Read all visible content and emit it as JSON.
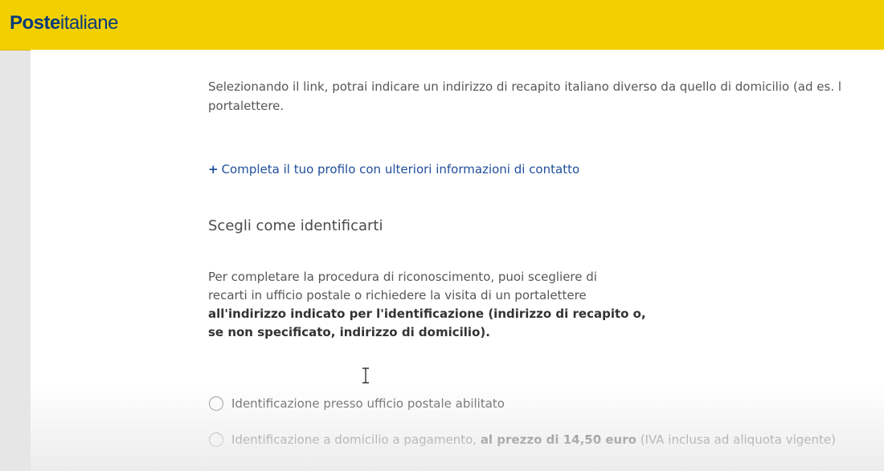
{
  "header": {
    "logo_bold": "Poste",
    "logo_light": "italiane"
  },
  "content": {
    "intro_line1": "Selezionando il link, potrai indicare un indirizzo di recapito italiano diverso da quello di domicilio (ad es. l",
    "intro_line2": "portalettere.",
    "link_plus": "+",
    "link_text": "Completa il tuo profilo con ulteriori informazioni di contatto",
    "section_title": "Scegli come identificarti",
    "desc_line1": "Per completare la procedura di riconoscimento, puoi scegliere di",
    "desc_line2": "recarti in ufficio postale o richiedere la visita di un portalettere",
    "desc_line3_bold": "all'indirizzo indicato per l'identificazione (indirizzo di recapito o,",
    "desc_line4_bold": "se non specificato, indirizzo di domicilio).",
    "options": [
      {
        "label": "Identificazione presso ufficio postale abilitato",
        "selected": false
      },
      {
        "label": "Identificazione a domicilio a pagamento, ",
        "label_bold": "al prezzo di 14,50 euro",
        "label_suffix": " (IVA inclusa ad aliquota vigente)",
        "selected": false
      }
    ]
  },
  "colors": {
    "header_bg": "#f2d000",
    "logo": "#0b3b7a",
    "link": "#1f4e9a",
    "text": "#575757"
  },
  "icons": {
    "cursor": "i-beam-cursor-icon",
    "radio": "radio-button-icon"
  }
}
